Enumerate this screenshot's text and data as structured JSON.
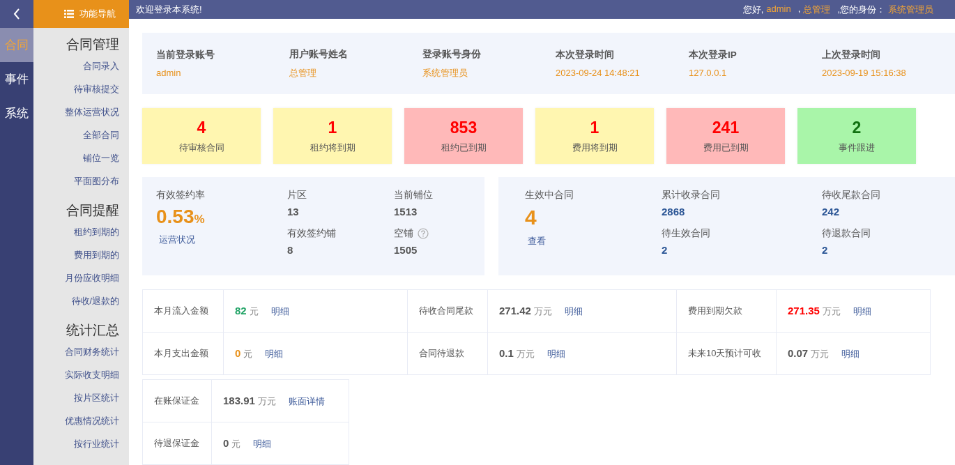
{
  "rail": {
    "items": [
      {
        "label": "合同",
        "selected": true
      },
      {
        "label": "事件",
        "selected": false
      },
      {
        "label": "系统",
        "selected": false
      }
    ]
  },
  "nav": {
    "title": "功能导航",
    "groups": [
      {
        "title": "合同管理",
        "items": [
          "合同录入",
          "待审核提交",
          "整体运营状况",
          "全部合同",
          "铺位一览",
          "平面图分布"
        ]
      },
      {
        "title": "合同提醒",
        "items": [
          "租约到期的",
          "费用到期的",
          "月份应收明细",
          "待收/退款的"
        ]
      },
      {
        "title": "统计汇总",
        "items": [
          "合同财务统计",
          "实际收支明细",
          "按片区统计",
          "优惠情况统计",
          "按行业统计"
        ]
      }
    ]
  },
  "header": {
    "welcome": "欢迎登录本系统!",
    "greeting": "您好,",
    "user": "admin",
    "sep": ",",
    "name": "总管理",
    "role_label": ",您的身份：",
    "role": "系统管理员"
  },
  "login_info": [
    {
      "label": "当前登录账号",
      "value": "admin"
    },
    {
      "label": "用户账号姓名",
      "value": "总管理"
    },
    {
      "label": "登录账号身份",
      "value": "系统管理员"
    },
    {
      "label": "本次登录时间",
      "value": "2023-09-24 14:48:21"
    },
    {
      "label": "本次登录IP",
      "value": "127.0.0.1"
    },
    {
      "label": "上次登录时间",
      "value": "2023-09-19 15:16:38"
    }
  ],
  "stat_cards": [
    {
      "value": "4",
      "label": "待审核合同",
      "kind": "warning"
    },
    {
      "value": "1",
      "label": "租约将到期",
      "kind": "warning"
    },
    {
      "value": "853",
      "label": "租约已到期",
      "kind": "danger"
    },
    {
      "value": "1",
      "label": "费用将到期",
      "kind": "warning"
    },
    {
      "value": "241",
      "label": "费用已到期",
      "kind": "danger"
    },
    {
      "value": "2",
      "label": "事件跟进",
      "kind": "success"
    }
  ],
  "operations": {
    "rate_label": "有效签约率",
    "rate": "0.53",
    "rate_unit": "%",
    "link": "运营状况",
    "metrics": [
      {
        "label": "片区",
        "value": "13",
        "help": false
      },
      {
        "label": "当前铺位",
        "value": "1513",
        "help": false
      },
      {
        "label": "有效签约铺",
        "value": "8",
        "help": false
      },
      {
        "label": "空铺",
        "value": "1505",
        "help": true
      }
    ]
  },
  "contracts": {
    "main_label": "生效中合同",
    "main_value": "4",
    "link": "查看",
    "metrics": [
      {
        "label": "累计收录合同",
        "value": "2868"
      },
      {
        "label": "待收尾款合同",
        "value": "242"
      },
      {
        "label": "待生效合同",
        "value": "2"
      },
      {
        "label": "待退款合同",
        "value": "2"
      }
    ]
  },
  "finance": [
    [
      {
        "label": "本月流入金额",
        "amount": "82",
        "unit": "元",
        "kind": "positive",
        "link": "明细"
      },
      {
        "label": "待收合同尾款",
        "amount": "271.42",
        "unit": "万元",
        "kind": "neutral",
        "link": "明细"
      },
      {
        "label": "费用到期欠款",
        "amount": "271.35",
        "unit": "万元",
        "kind": "negative",
        "link": "明细"
      }
    ],
    [
      {
        "label": "本月支出金额",
        "amount": "0",
        "unit": "元",
        "kind": "warning",
        "link": "明细"
      },
      {
        "label": "合同待退款",
        "amount": "0.1",
        "unit": "万元",
        "kind": "neutral",
        "link": "明细"
      },
      {
        "label": "未来10天预计可收",
        "amount": "0.07",
        "unit": "万元",
        "kind": "neutral",
        "link": "明细"
      }
    ]
  ],
  "deposits": [
    {
      "label": "在账保证金",
      "amount": "183.91",
      "unit": "万元",
      "link": "账面详情"
    },
    {
      "label": "待退保证金",
      "amount": "0",
      "unit": "元",
      "link": "明细"
    }
  ]
}
